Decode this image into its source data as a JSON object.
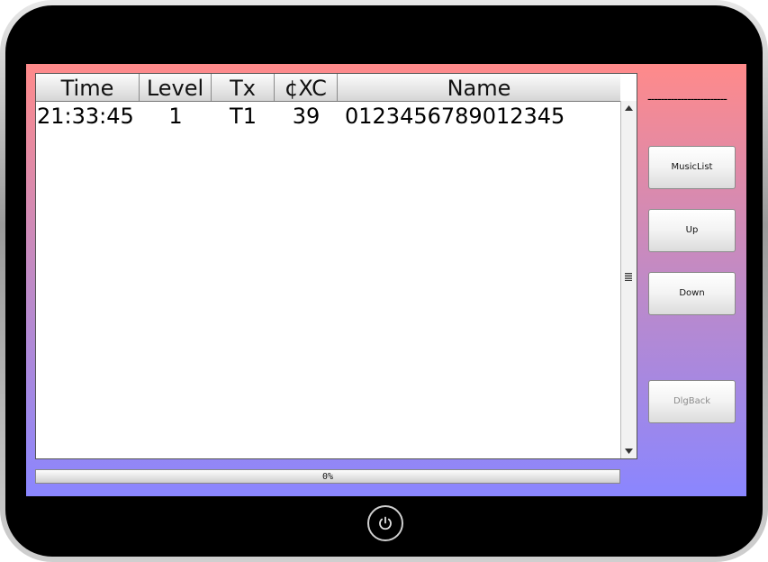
{
  "list": {
    "columns": [
      {
        "key": "time",
        "label": "Time"
      },
      {
        "key": "level",
        "label": "Level"
      },
      {
        "key": "tx",
        "label": "Tx"
      },
      {
        "key": "xc",
        "label": "¢XC"
      },
      {
        "key": "name",
        "label": "Name"
      }
    ],
    "rows": [
      {
        "time": "21:33:45",
        "level": "1",
        "tx": "T1",
        "xc": "39",
        "name": "0123456789012345"
      }
    ]
  },
  "progress": {
    "value": 0,
    "label": "0%"
  },
  "side": {
    "status_text": "------------------------",
    "buttons": {
      "music_list": "MusicList",
      "up": "Up",
      "down": "Down",
      "dlg_back": "DlgBack"
    }
  },
  "icons": {
    "power": "power-icon",
    "scroll_up": "triangle-up-icon",
    "scroll_down": "triangle-down-icon",
    "scroll_grip": "grip-lines-icon"
  },
  "colors": {
    "screen_top": "#ff8a8a",
    "screen_bottom": "#8a86ff",
    "progress_fill": "#4a9cff"
  }
}
